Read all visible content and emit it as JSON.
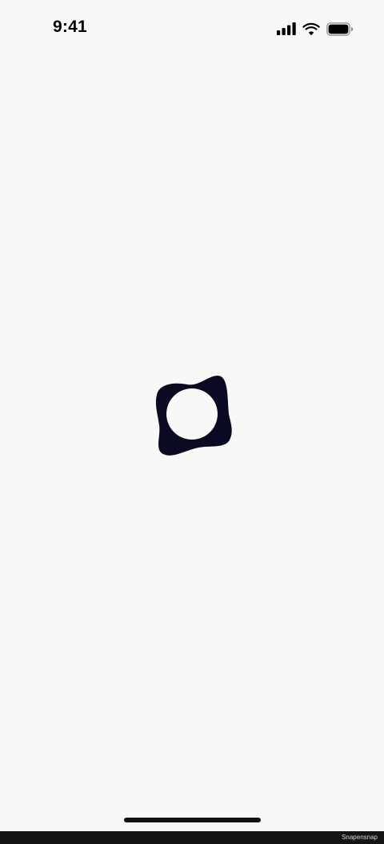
{
  "status_bar": {
    "time": "9:41",
    "icons": [
      "signal-icon",
      "wifi-icon",
      "battery-icon"
    ]
  },
  "loader": {
    "icon": "loading-spinner-icon",
    "color": "#0a0a23"
  },
  "watermark": {
    "text": "Snapensnap"
  },
  "colors": {
    "background": "#f8f8f6",
    "foreground": "#000000",
    "watermark_bar": "#141414"
  }
}
